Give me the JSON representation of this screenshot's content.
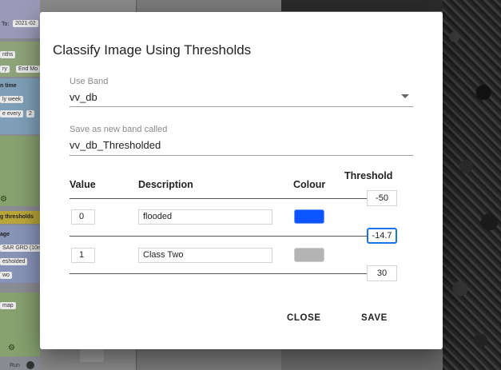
{
  "background": {
    "left_panel_texts": [
      "To:",
      "2021-02",
      "nths",
      "ry",
      "End Mo",
      "n time",
      "ly week",
      "e every",
      "2",
      "g thresholds",
      "age",
      "SAR GRD (10m",
      "esholded",
      "wo",
      "map",
      "Run"
    ]
  },
  "dialog": {
    "title": "Classify Image Using Thresholds",
    "band_field": {
      "label": "Use Band",
      "value": "vv_db"
    },
    "new_band_field": {
      "label": "Save as new band called",
      "value": "vv_db_Thresholded"
    },
    "table": {
      "headers": {
        "value": "Value",
        "description": "Description",
        "colour": "Colour",
        "threshold": "Threshold"
      },
      "thresholds": [
        "-50",
        "-14.7",
        "30"
      ],
      "rows": [
        {
          "value": "0",
          "description": "flooded",
          "colour": "#0b54ff"
        },
        {
          "value": "1",
          "description": "Class Two",
          "colour": "#b4b4b4"
        }
      ]
    },
    "actions": {
      "close_label": "CLOSE",
      "save_label": "SAVE"
    }
  }
}
